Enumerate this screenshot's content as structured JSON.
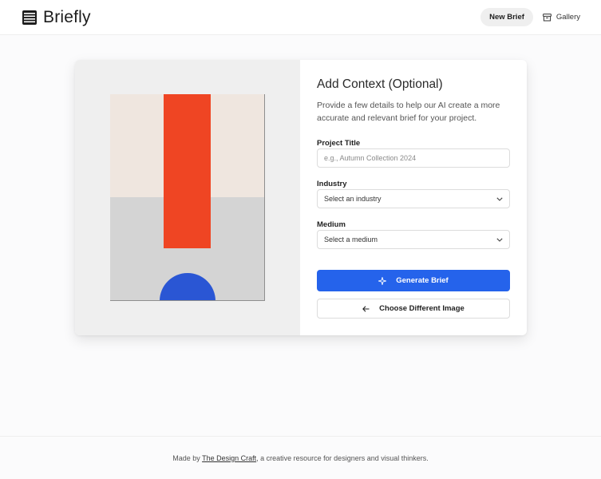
{
  "header": {
    "brand_name": "Briefly",
    "nav": {
      "new_brief_label": "New Brief",
      "gallery_label": "Gallery"
    }
  },
  "card": {
    "title": "Add Context (Optional)",
    "description": "Provide a few details to help our AI create a more accurate and relevant brief for your project.",
    "fields": {
      "project_title": {
        "label": "Project Title",
        "value": "",
        "placeholder": "e.g., Autumn Collection 2024"
      },
      "industry": {
        "label": "Industry",
        "selected": "Select an industry"
      },
      "medium": {
        "label": "Medium",
        "selected": "Select a medium"
      }
    },
    "generate_label": "Generate Brief",
    "choose_image_label": "Choose Different Image"
  },
  "footer": {
    "prefix": "Made by ",
    "link_text": "The Design Craft",
    "suffix": ", a creative resource for designers and visual thinkers."
  },
  "colors": {
    "accent": "#2563eb",
    "art_red": "#ef4523",
    "art_blue": "#2a56d4",
    "art_cream": "#efe6df",
    "art_gray": "#d4d4d4"
  },
  "icons": {
    "brand": "menu-lines-icon",
    "gallery": "archive-box-icon",
    "generate": "sparkles-icon",
    "back": "arrow-left-icon",
    "select": "chevron-down-icon"
  }
}
